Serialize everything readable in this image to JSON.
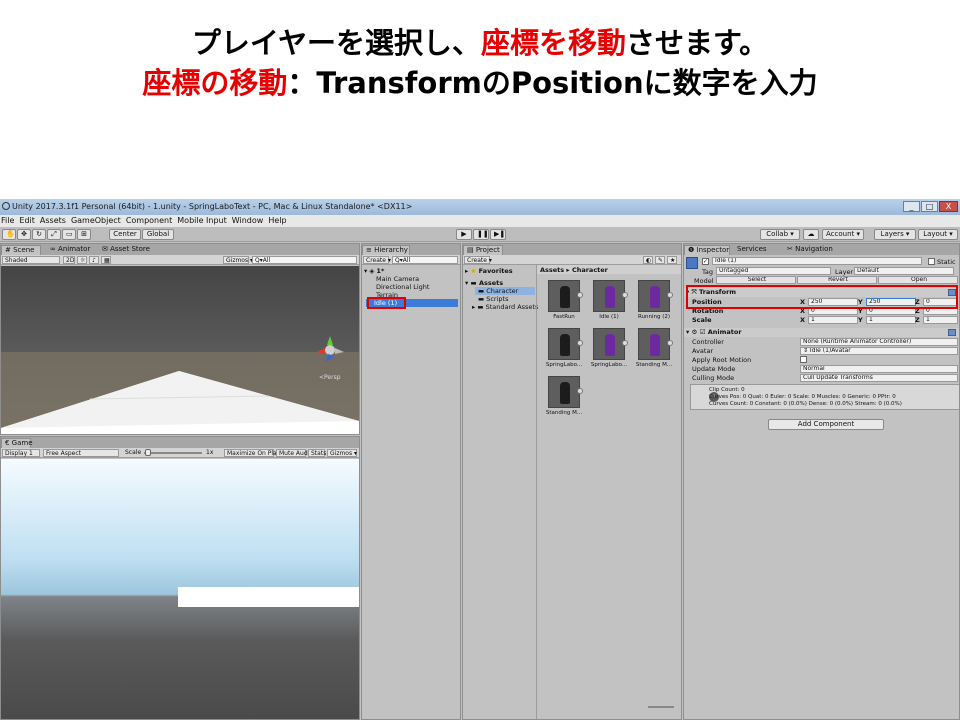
{
  "slide": {
    "line1_black_a": "プレイヤーを選択し、",
    "line1_red": "座標を移動",
    "line1_black_b": "させます。",
    "line2_red": "座標の移動",
    "line2_black": "：TransformのPositionに数字を入力"
  },
  "window": {
    "title": "Unity 2017.3.1f1 Personal (64bit) - 1.unity - SpringLaboText - PC, Mac & Linux Standalone* <DX11>",
    "min": "_",
    "max": "□",
    "close": "X"
  },
  "menu": [
    "File",
    "Edit",
    "Assets",
    "GameObject",
    "Component",
    "Mobile Input",
    "Window",
    "Help"
  ],
  "toolbar": {
    "center": "Center",
    "global": "Global",
    "play": "▶",
    "pause": "❚❚",
    "step": "▶❚",
    "collab": "Collab ▾",
    "cloud": "☁",
    "account": "Account ▾",
    "layers": "Layers ▾",
    "layout": "Layout ▾"
  },
  "scene_panel": {
    "tabs": [
      "# Scene",
      "∞ Animator",
      "✉ Asset Store"
    ],
    "shaded": "Shaded",
    "mode_2d": "2D",
    "gizmos": "Gizmos ▾",
    "search": "Q▾All",
    "persp": "<Persp"
  },
  "game_panel": {
    "tab": "€ Game",
    "display": "Display 1",
    "aspect": "Free Aspect",
    "scale_label": "Scale",
    "scale_value": "1x",
    "maximize": "Maximize On Play",
    "mute": "Mute Audio",
    "stats": "Stats",
    "gizmos": "Gizmos ▾"
  },
  "hierarchy": {
    "tab": "≡ Hierarchy",
    "create": "Create ▾",
    "search": "Q▾All",
    "scene": "1*",
    "items": [
      "Main Camera",
      "Directional Light",
      "Terrain",
      "Idle (1)"
    ]
  },
  "project": {
    "tab": "▤ Project",
    "create": "Create ▾",
    "favorites": "Favorites",
    "assets": "Assets",
    "folders": [
      "Character",
      "Scripts",
      "Standard Assets"
    ],
    "breadcrumb": "Assets ▸ Character",
    "items": [
      {
        "label": "FastRun",
        "purple": false
      },
      {
        "label": "Idle (1)",
        "purple": true
      },
      {
        "label": "Running (2)",
        "purple": true
      },
      {
        "label": "SpringLabo...",
        "purple": false
      },
      {
        "label": "SpringLabo...",
        "purple": true
      },
      {
        "label": "Standing M...",
        "purple": true
      },
      {
        "label": "Standing M...",
        "purple": false
      }
    ]
  },
  "inspector": {
    "tabs": [
      "❶ Inspector",
      "Services",
      "✂ Navigation"
    ],
    "object_name": "Idle (1)",
    "static": "Static",
    "tag_label": "Tag",
    "tag_value": "Untagged",
    "layer_label": "Layer",
    "layer_value": "Default",
    "model": "Model",
    "select": "Select",
    "revert": "Revert",
    "open": "Open",
    "transform": {
      "title": "Transform",
      "position": {
        "label": "Position",
        "x": "250",
        "y": "250",
        "z": "0"
      },
      "rotation": {
        "label": "Rotation",
        "x": "0",
        "y": "0",
        "z": "0"
      },
      "scale": {
        "label": "Scale",
        "x": "1",
        "y": "1",
        "z": "1"
      }
    },
    "animator": {
      "title": "Animator",
      "controller_label": "Controller",
      "controller_value": "None (Runtime Animator Controller)",
      "avatar_label": "Avatar",
      "avatar_value": "⇕ Idle (1)Avatar",
      "root_motion_label": "Apply Root Motion",
      "update_mode_label": "Update Mode",
      "update_mode_value": "Normal",
      "culling_label": "Culling Mode",
      "culling_value": "Cull Update Transforms"
    },
    "info_lines": [
      "Clip Count: 0",
      "Curves Pos: 0 Quat: 0 Euler: 0 Scale: 0 Muscles: 0 Generic: 0 PPtr: 0",
      "Curves Count: 0 Constant: 0 (0.0%) Dense: 0 (0.0%) Stream: 0 (0.0%)"
    ],
    "add_component": "Add Component"
  },
  "colors": {
    "accent_red": "#e60000",
    "highlight_frame": "#e00000",
    "unity_panel": "#c2c2c2"
  }
}
